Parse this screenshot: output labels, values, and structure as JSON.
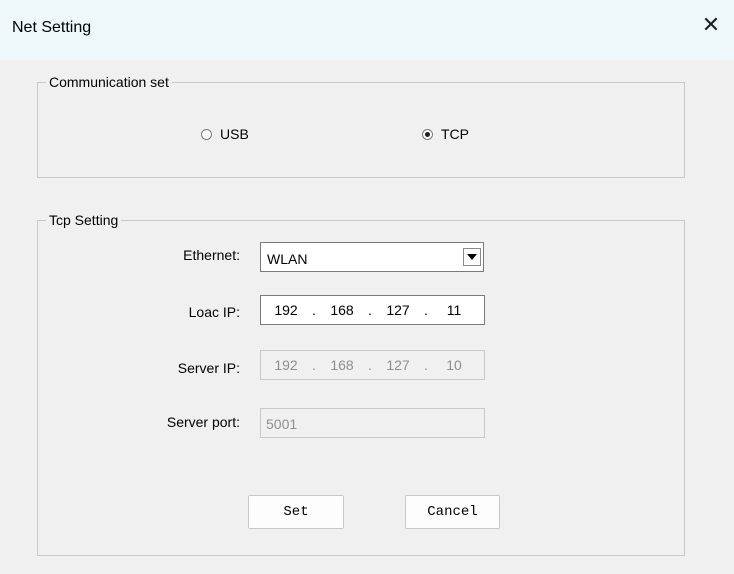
{
  "window": {
    "title": "Net Setting",
    "close_glyph": "✕"
  },
  "communication": {
    "legend": "Communication set",
    "options": [
      {
        "label": "USB",
        "checked": false
      },
      {
        "label": "TCP",
        "checked": true
      }
    ]
  },
  "tcp": {
    "legend": "Tcp Setting",
    "ethernet": {
      "label": "Ethernet:",
      "value": "WLAN"
    },
    "local_ip": {
      "label": "Loac IP:",
      "octets": [
        "192",
        "168",
        "127",
        "11"
      ],
      "separator": "."
    },
    "server_ip": {
      "label": "Server IP:",
      "octets": [
        "192",
        "168",
        "127",
        "10"
      ],
      "separator": "."
    },
    "server_port": {
      "label": "Server port:",
      "value": "5001"
    }
  },
  "buttons": {
    "set_label": "Set",
    "cancel_label": "Cancel"
  }
}
